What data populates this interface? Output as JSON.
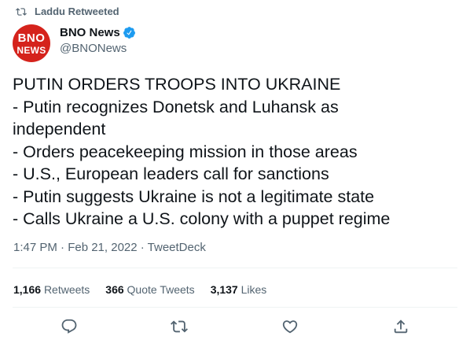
{
  "retweet_banner": {
    "text": "Laddu Retweeted",
    "icon": "retweet-icon"
  },
  "author": {
    "avatar_line1": "BNO",
    "avatar_line2": "NEWS",
    "name": "BNO News",
    "handle": "@BNONews",
    "verified": true
  },
  "tweet": {
    "lines": [
      "PUTIN ORDERS TROOPS INTO UKRAINE",
      "- Putin recognizes Donetsk and Luhansk as",
      "independent",
      "- Orders peacekeeping mission in those areas",
      "- U.S., European leaders call for sanctions",
      "- Putin suggests Ukraine is not a legitimate state",
      "- Calls Ukraine a U.S. colony with a puppet regime"
    ],
    "timestamp": "1:47 PM · Feb 21, 2022 · TweetDeck"
  },
  "stats": {
    "retweets": {
      "count": "1,166",
      "label": "Retweets"
    },
    "quote_tweets": {
      "count": "366",
      "label": "Quote Tweets"
    },
    "likes": {
      "count": "3,137",
      "label": "Likes"
    }
  },
  "actions": [
    "reply-icon",
    "retweet-icon",
    "like-icon",
    "share-icon"
  ],
  "colors": {
    "text": "#0f1419",
    "secondary": "#536471",
    "verified": "#1d9bf0",
    "avatar_bg": "#d5231c",
    "divider": "#eff3f4"
  }
}
